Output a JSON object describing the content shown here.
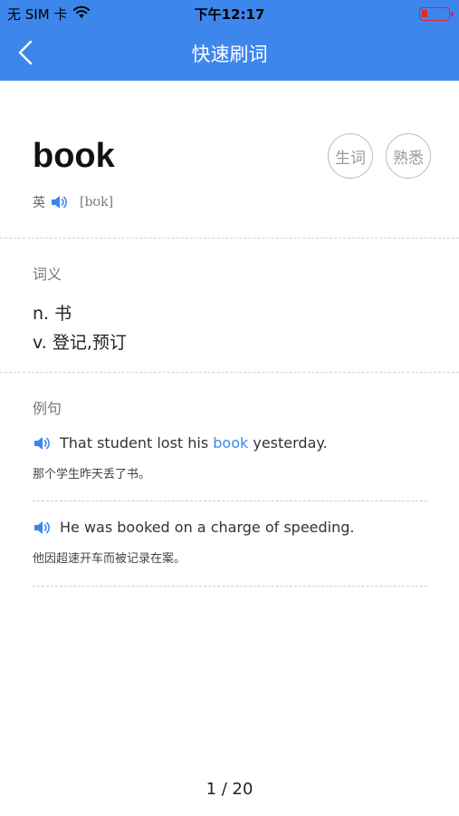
{
  "status_bar": {
    "carrier": "无 SIM 卡",
    "time": "下午12:17"
  },
  "nav": {
    "title": "快速刷词"
  },
  "word": {
    "text": "book",
    "accent": "英",
    "phonetic": "[bʊk]",
    "button_new": "生词",
    "button_familiar": "熟悉"
  },
  "definitions": {
    "label": "词义",
    "items": [
      "n. 书",
      "v. 登记,预订"
    ]
  },
  "examples": {
    "label": "例句",
    "items": [
      {
        "en_before": "That student lost his ",
        "en_highlight": "book",
        "en_after": " yesterday.",
        "cn": "那个学生昨天丢了书。"
      },
      {
        "en_before": "He was booked on a charge of speeding.",
        "en_highlight": "",
        "en_after": "",
        "cn": "他因超速开车而被记录在案。"
      }
    ]
  },
  "pager": {
    "text": "1 / 20"
  },
  "colors": {
    "accent": "#3d86ec",
    "battery_low": "#e22222"
  },
  "icons": {
    "back": "chevron-left-icon",
    "speaker": "speaker-icon",
    "wifi": "wifi-icon",
    "battery": "battery-icon"
  }
}
